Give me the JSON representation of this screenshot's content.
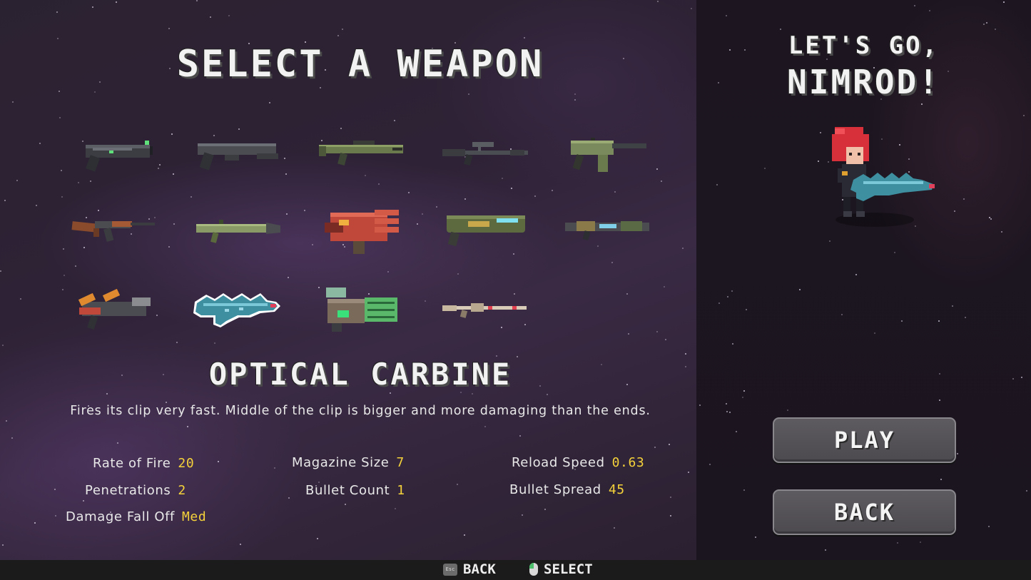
{
  "title": "SELECT A WEAPON",
  "selected_weapon": {
    "name": "OPTICAL CARBINE",
    "description": "Fires its clip very fast. Middle of the clip is bigger and more damaging than the ends."
  },
  "stats": [
    {
      "label": "Rate of Fire",
      "value": "20"
    },
    {
      "label": "Penetrations",
      "value": "2"
    },
    {
      "label": "Damage Fall Off",
      "value": "Med"
    },
    {
      "label": "Magazine Size",
      "value": "7"
    },
    {
      "label": "Bullet Count",
      "value": "1"
    },
    {
      "label": "Reload Speed",
      "value": "0.63"
    },
    {
      "label": "Bullet Spread",
      "value": "45"
    }
  ],
  "weapons": [
    {
      "icon": "pistol-icon"
    },
    {
      "icon": "heavy-pistol-icon"
    },
    {
      "icon": "green-rifle-icon"
    },
    {
      "icon": "sniper-rifle-icon"
    },
    {
      "icon": "smg-icon"
    },
    {
      "icon": "assault-rifle-icon"
    },
    {
      "icon": "rocket-launcher-icon"
    },
    {
      "icon": "red-blaster-icon"
    },
    {
      "icon": "plasma-cannon-icon"
    },
    {
      "icon": "laser-rifle-icon"
    },
    {
      "icon": "flame-gun-icon"
    },
    {
      "icon": "optical-carbine-icon",
      "selected": true
    },
    {
      "icon": "gatling-cannon-icon"
    },
    {
      "icon": "needle-rifle-icon"
    }
  ],
  "sidebar": {
    "greeting": "LET'S GO,",
    "player_name": "NIMROD!",
    "play_label": "PLAY",
    "back_label": "BACK"
  },
  "hints": {
    "back_key": "Esc",
    "back_label": "BACK",
    "select_label": "SELECT"
  },
  "colors": {
    "stat_value": "#f5d23a",
    "selection_outline": "#ffffff",
    "carbine_body": "#3e8fa0"
  }
}
